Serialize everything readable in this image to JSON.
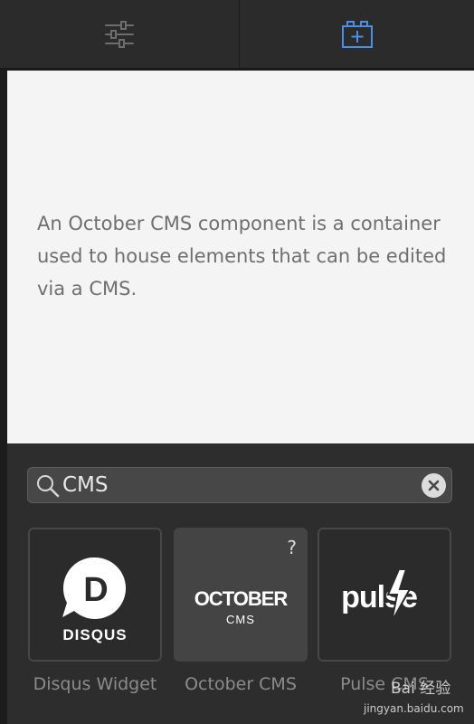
{
  "tabs": {
    "settings": {
      "icon": "sliders-icon",
      "active": false
    },
    "add_component": {
      "icon": "add-block-icon",
      "active": true,
      "accent": "#4a90e2"
    }
  },
  "info": {
    "description": "An October CMS component is a container used to house elements that can be edited via a CMS."
  },
  "search": {
    "value": "CMS",
    "icon": "search-icon",
    "clear_icon": "clear-icon"
  },
  "components": [
    {
      "label": "Disqus Widget",
      "logo_text": "DISQUS",
      "logo_letter": "D",
      "icon": "disqus-logo-icon"
    },
    {
      "label": "October CMS",
      "logo_text": "OCTOBER",
      "logo_sub": "CMS",
      "help": "?",
      "icon": "october-logo-icon"
    },
    {
      "label": "Pulse CMS",
      "logo_text": "pulse",
      "icon": "pulse-logo-icon"
    }
  ],
  "watermark": {
    "top": "Bai 经验",
    "bottom": "jingyan.baidu.com"
  }
}
